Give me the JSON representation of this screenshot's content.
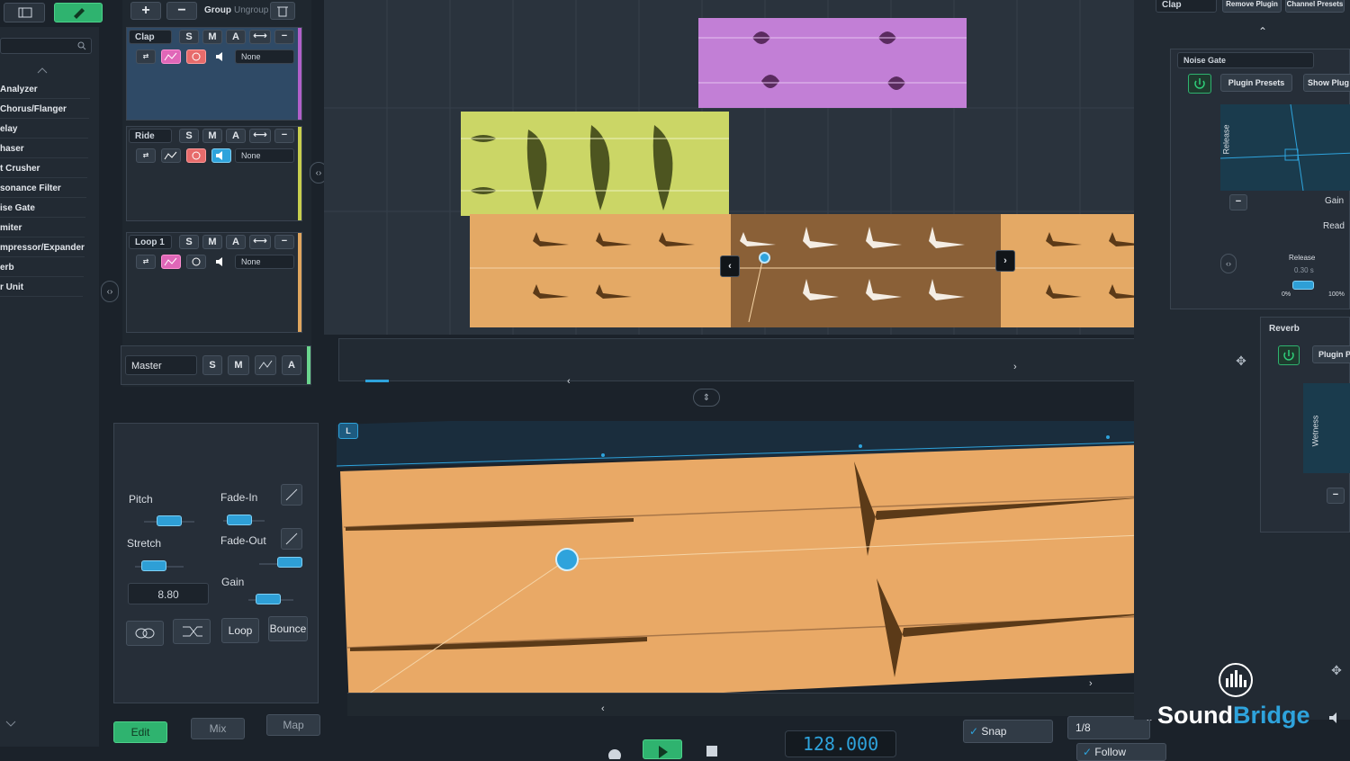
{
  "brand": {
    "name_part1": "Sound",
    "name_part2": "Bridge",
    "accent": "#2ea3dc",
    "green": "#2fb36f"
  },
  "plugin_list": [
    "Analyzer",
    "Chorus/Flanger",
    "elay",
    "haser",
    "t Crusher",
    "sonance Filter",
    "ise Gate",
    "miter",
    "mpressor/Expander",
    "erb",
    "r Unit"
  ],
  "track_toolbar": {
    "group": "Group",
    "ungroup": "Ungroup"
  },
  "tracks": [
    {
      "name": "Clap",
      "s": "S",
      "m": "M",
      "a": "A",
      "output": "None",
      "color": "#b160c9"
    },
    {
      "name": "Ride",
      "s": "S",
      "m": "M",
      "a": "A",
      "output": "None",
      "color": "#c8cf4e"
    },
    {
      "name": "Loop 1",
      "s": "S",
      "m": "M",
      "a": "A",
      "output": "None",
      "color": "#e0a65f"
    }
  ],
  "master": {
    "name": "Master",
    "s": "S",
    "m": "M",
    "a": "A"
  },
  "clip_editor": {
    "pitch": "Pitch",
    "stretch": "Stretch",
    "fade_in": "Fade-In",
    "fade_out": "Fade-Out",
    "gain": "Gain",
    "value": "8.80",
    "loop": "Loop",
    "bounce": "Bounce",
    "marker": "L"
  },
  "bottom_tabs": {
    "edit": "Edit",
    "mix": "Mix",
    "map": "Map"
  },
  "transport": {
    "tempo": "128.000",
    "snap": "Snap",
    "grid": "1/8",
    "follow": "Follow"
  },
  "right_panel": {
    "track": "Clap",
    "remove_plugin": "Remove Plugin",
    "channel_presets": "Channel Presets",
    "noise_gate": "Noise Gate",
    "plugin_presets": "Plugin Presets",
    "show_plugin": "Show Plug",
    "release": "Release",
    "gain": "Gain",
    "read": "Read",
    "release_knob": "Release",
    "release_value": "0.30 s",
    "pct0": "0%",
    "pct100": "100%",
    "reverb": "Reverb",
    "plugin_presets2": "Plugin P",
    "wetness": "Wetness"
  }
}
